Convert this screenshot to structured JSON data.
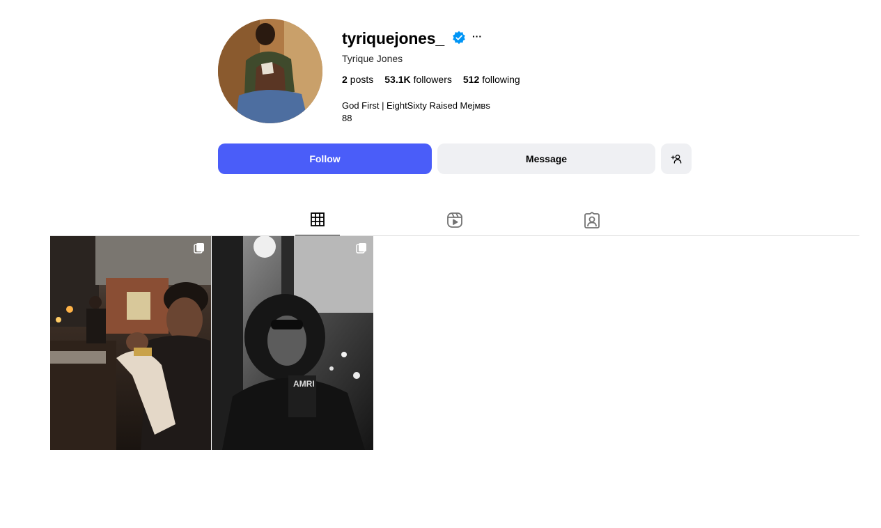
{
  "profile": {
    "username": "tyriquejones_",
    "full_name": "Tyrique Jones",
    "verified": true,
    "more_label": "···",
    "stats": {
      "posts_value": "2",
      "posts_label": "posts",
      "followers_value": "53.1K",
      "followers_label": "followers",
      "following_value": "512",
      "following_label": "following"
    },
    "bio_line1": "God First | EightSixty Raised Meјмвѕ",
    "bio_line2": "88"
  },
  "actions": {
    "follow_label": "Follow",
    "message_label": "Message",
    "add_icon": "person-add-icon"
  },
  "tabs": [
    {
      "icon": "grid-icon",
      "active": true
    },
    {
      "icon": "reels-icon",
      "active": false
    },
    {
      "icon": "tagged-icon",
      "active": false
    }
  ],
  "posts": [
    {
      "type": "carousel",
      "icon": "multi-photo-icon",
      "tone": "warm color restaurant scene"
    },
    {
      "type": "carousel",
      "icon": "multi-photo-icon",
      "tone": "black and white portrait"
    }
  ],
  "colors": {
    "accent": "#4a5df9",
    "verified": "#0095f6",
    "button_secondary": "#eff0f3",
    "divider": "#dbdbdb"
  }
}
